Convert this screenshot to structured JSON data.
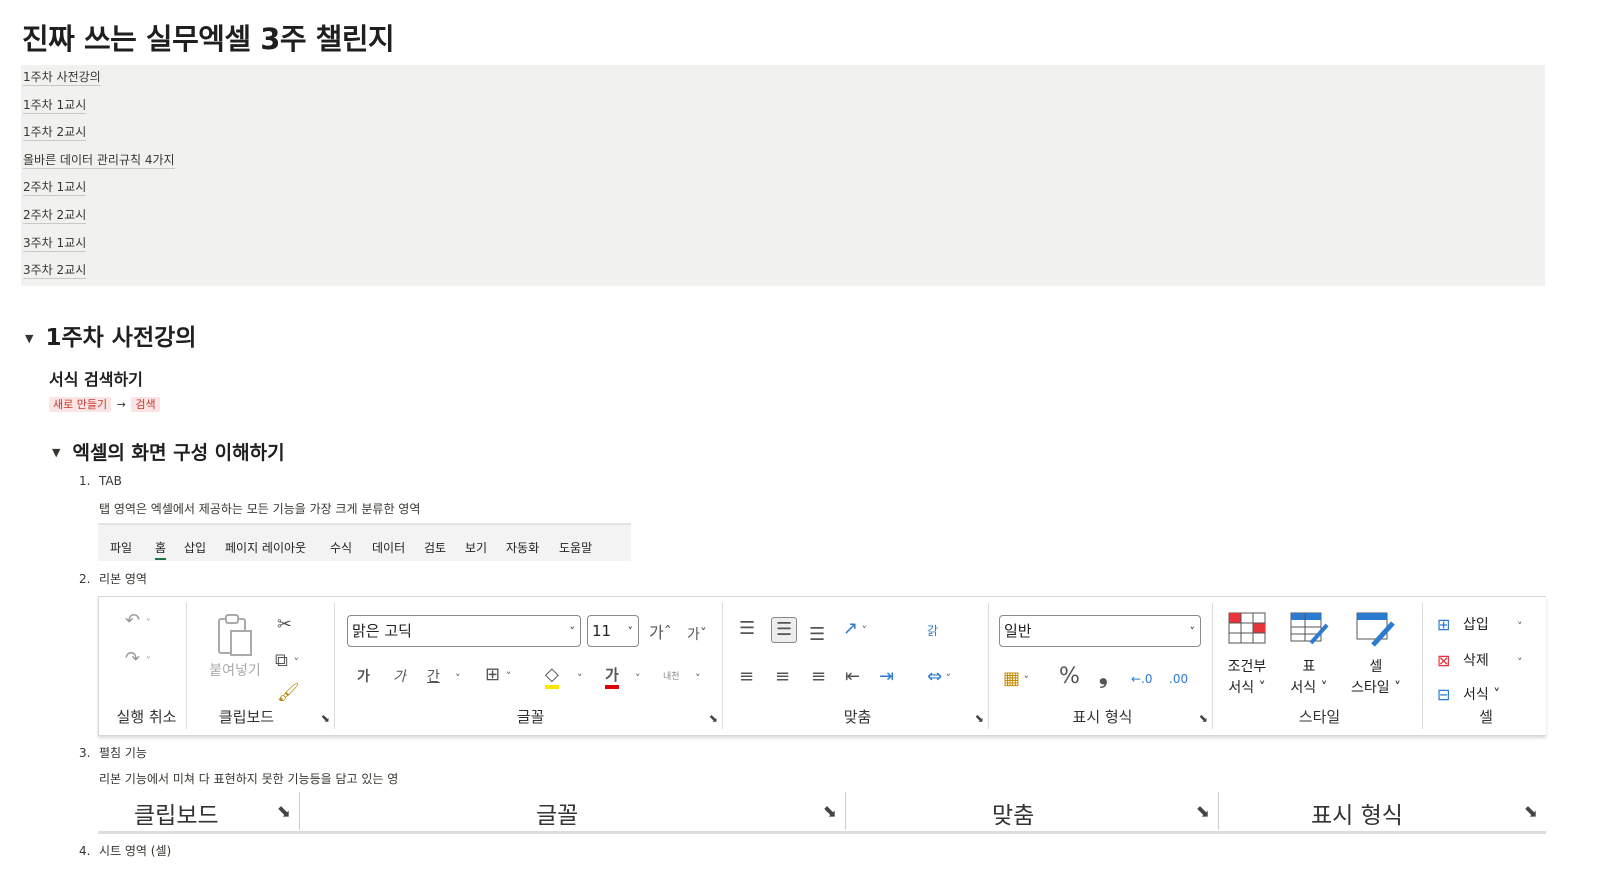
{
  "page": {
    "title": "진짜 쓰는 실무엑셀 3주 챌린지"
  },
  "toc": [
    "1주차 사전강의",
    "1주차 1교시",
    "1주차 2교시",
    "올바른 데이터 관리규칙 4가지",
    "2주차 1교시",
    "2주차 2교시",
    "3주차 1교시",
    "3주차 2교시"
  ],
  "section1": {
    "heading": "1주차 사전강의",
    "sub_heading": "서식 검색하기",
    "tag1": "새로 만들기",
    "arrow": "→",
    "tag2": "검색",
    "toggle_heading": "엑셀의 화면 구성 이해하기",
    "items": [
      {
        "num": "1.",
        "label": "TAB",
        "desc": "탭 영역은 엑셀에서 제공하는 모든 기능을 가장 크게 분류한 영역"
      },
      {
        "num": "2.",
        "label": "리본 영역"
      },
      {
        "num": "3.",
        "label": "펼침 기능",
        "desc": "리본 기능에서 미쳐 다 표현하지 못한 기능등을 담고 있는 영"
      },
      {
        "num": "4.",
        "label": "시트 영역 (셀)"
      }
    ]
  },
  "tabbar": [
    "파일",
    "홈",
    "삽입",
    "페이지 레이아웃",
    "수식",
    "데이터",
    "검토",
    "보기",
    "자동화",
    "도움말"
  ],
  "ribbon": {
    "undo_group": "실행 취소",
    "clipboard_group": "클립보드",
    "paste_label": "붙여넣기",
    "font_group": "글꼴",
    "font_name": "맑은 고딕",
    "font_size": "11",
    "grow_font": "가ˆ",
    "shrink_font": "가ˇ",
    "bold": "가",
    "italic": "가",
    "underline": "간",
    "font_color": "가",
    "phonetic": "내천",
    "align_group": "맞춤",
    "wrap": "갉",
    "number_group": "표시 형식",
    "number_format": "일반",
    "percent": "%",
    "comma": "❟",
    "style_group": "스타일",
    "cond_format_1": "조건부",
    "cond_format_2": "서식 ˅",
    "table_format_1": "표",
    "table_format_2": "서식 ˅",
    "cell_style_1": "셀",
    "cell_style_2": "스타일 ˅",
    "cells_group": "셀",
    "insert": "삽입",
    "delete": "삭제",
    "format": "서식 ˅"
  },
  "expand_bar": [
    "클립보드",
    "글꼴",
    "맞춤",
    "표시 형식"
  ],
  "colors": {
    "accent_green": "#217346",
    "tag_bg": "#fbe4e4",
    "tag_text": "#c6382f",
    "fill_yellow": "#ffe600",
    "font_red": "#e00000"
  }
}
